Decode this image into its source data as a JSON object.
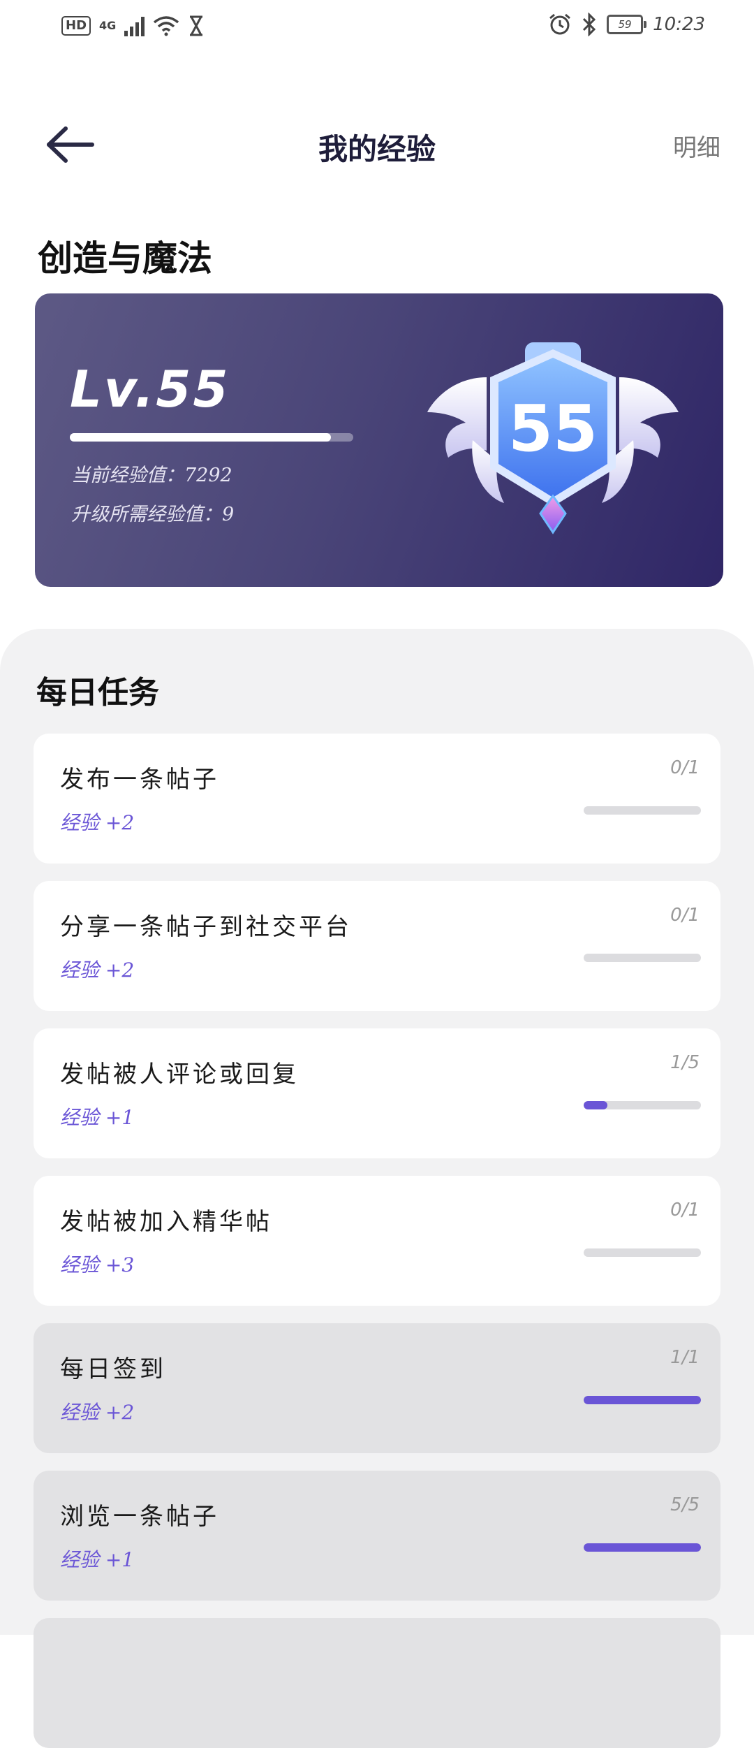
{
  "status_bar": {
    "hd": "HD",
    "network": "4G",
    "battery": "59",
    "time": "10:23"
  },
  "header": {
    "title": "我的经验",
    "detail_link": "明细"
  },
  "level_card": {
    "section_name": "创造与魔法",
    "level_label": "Lv.55",
    "badge_number": "55",
    "progress_fraction": 0.92,
    "current_xp": "当前经验值：7292",
    "needed_xp": "升级所需经验值：9"
  },
  "daily_tasks": {
    "title": "每日任务",
    "items": [
      {
        "name": "发布一条帖子",
        "xp": "经验 +2",
        "progress_text": "0/1",
        "done": 0,
        "total": 1,
        "completed": false
      },
      {
        "name": "分享一条帖子到社交平台",
        "xp": "经验 +2",
        "progress_text": "0/1",
        "done": 0,
        "total": 1,
        "completed": false
      },
      {
        "name": "发帖被人评论或回复",
        "xp": "经验 +1",
        "progress_text": "1/5",
        "done": 1,
        "total": 5,
        "completed": false
      },
      {
        "name": "发帖被加入精华帖",
        "xp": "经验 +3",
        "progress_text": "0/1",
        "done": 0,
        "total": 1,
        "completed": false
      },
      {
        "name": "每日签到",
        "xp": "经验 +2",
        "progress_text": "1/1",
        "done": 1,
        "total": 1,
        "completed": true
      },
      {
        "name": "浏览一条帖子",
        "xp": "经验 +1",
        "progress_text": "5/5",
        "done": 5,
        "total": 5,
        "completed": true
      }
    ]
  },
  "colors": {
    "accent": "#6a55d6",
    "card_gradient_start": "#5d5985",
    "card_gradient_end": "#2f2666",
    "title_color": "#1e1d3a"
  }
}
